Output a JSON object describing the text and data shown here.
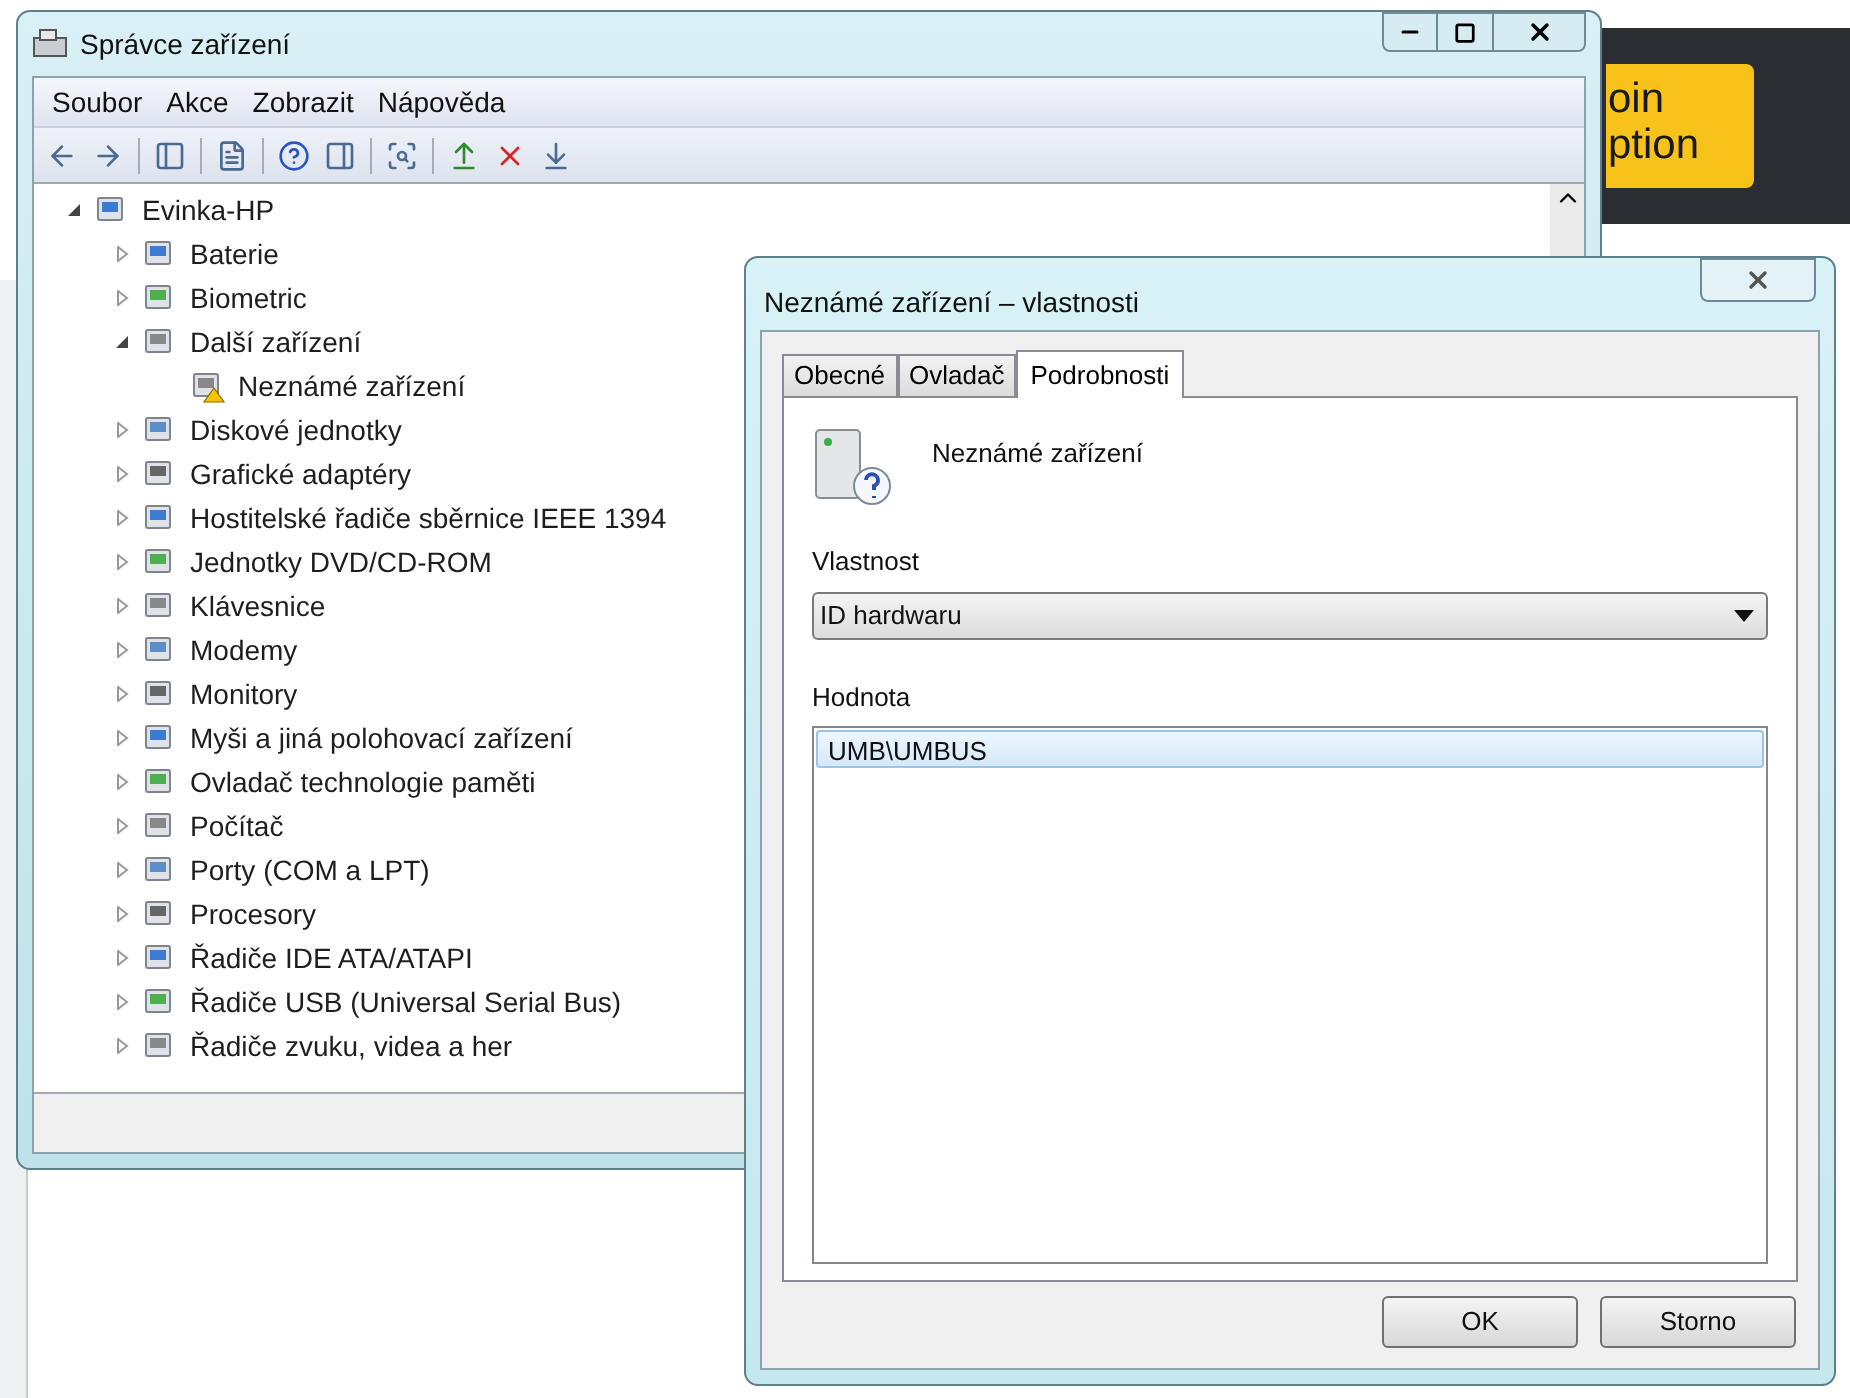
{
  "background_ad": {
    "lines": [
      "oin",
      "ption"
    ]
  },
  "main_window": {
    "title": "Správce zařízení",
    "menu": [
      "Soubor",
      "Akce",
      "Zobrazit",
      "Nápověda"
    ],
    "tree": {
      "label": "Evinka-HP",
      "expanded": true,
      "children": [
        {
          "label": "Baterie",
          "expanded": false
        },
        {
          "label": "Biometric",
          "expanded": false
        },
        {
          "label": "Další zařízení",
          "expanded": true,
          "children": [
            {
              "label": "Neznámé zařízení",
              "warning": true
            }
          ]
        },
        {
          "label": "Diskové jednotky",
          "expanded": false
        },
        {
          "label": "Grafické adaptéry",
          "expanded": false
        },
        {
          "label": "Hostitelské řadiče sběrnice IEEE 1394",
          "expanded": false
        },
        {
          "label": "Jednotky DVD/CD-ROM",
          "expanded": false
        },
        {
          "label": "Klávesnice",
          "expanded": false
        },
        {
          "label": "Modemy",
          "expanded": false
        },
        {
          "label": "Monitory",
          "expanded": false
        },
        {
          "label": "Myši a jiná polohovací zařízení",
          "expanded": false
        },
        {
          "label": "Ovladač technologie paměti",
          "expanded": false
        },
        {
          "label": "Počítač",
          "expanded": false
        },
        {
          "label": "Porty (COM a LPT)",
          "expanded": false
        },
        {
          "label": "Procesory",
          "expanded": false
        },
        {
          "label": "Řadiče IDE ATA/ATAPI",
          "expanded": false
        },
        {
          "label": "Řadiče USB (Universal Serial Bus)",
          "expanded": false
        },
        {
          "label": "Řadiče zvuku, videa a her",
          "expanded": false
        }
      ]
    }
  },
  "dialog": {
    "title": "Neznámé zařízení – vlastnosti",
    "tabs": [
      {
        "label": "Obecné",
        "selected": false
      },
      {
        "label": "Ovladač",
        "selected": false
      },
      {
        "label": "Podrobnosti",
        "selected": true
      }
    ],
    "device_name": "Neznámé zařízení",
    "property_label": "Vlastnost",
    "property_value": "ID hardwaru",
    "value_label": "Hodnota",
    "values": [
      {
        "text": "UMB\\UMBUS",
        "selected": true
      }
    ],
    "buttons": [
      "OK",
      "Storno"
    ]
  }
}
